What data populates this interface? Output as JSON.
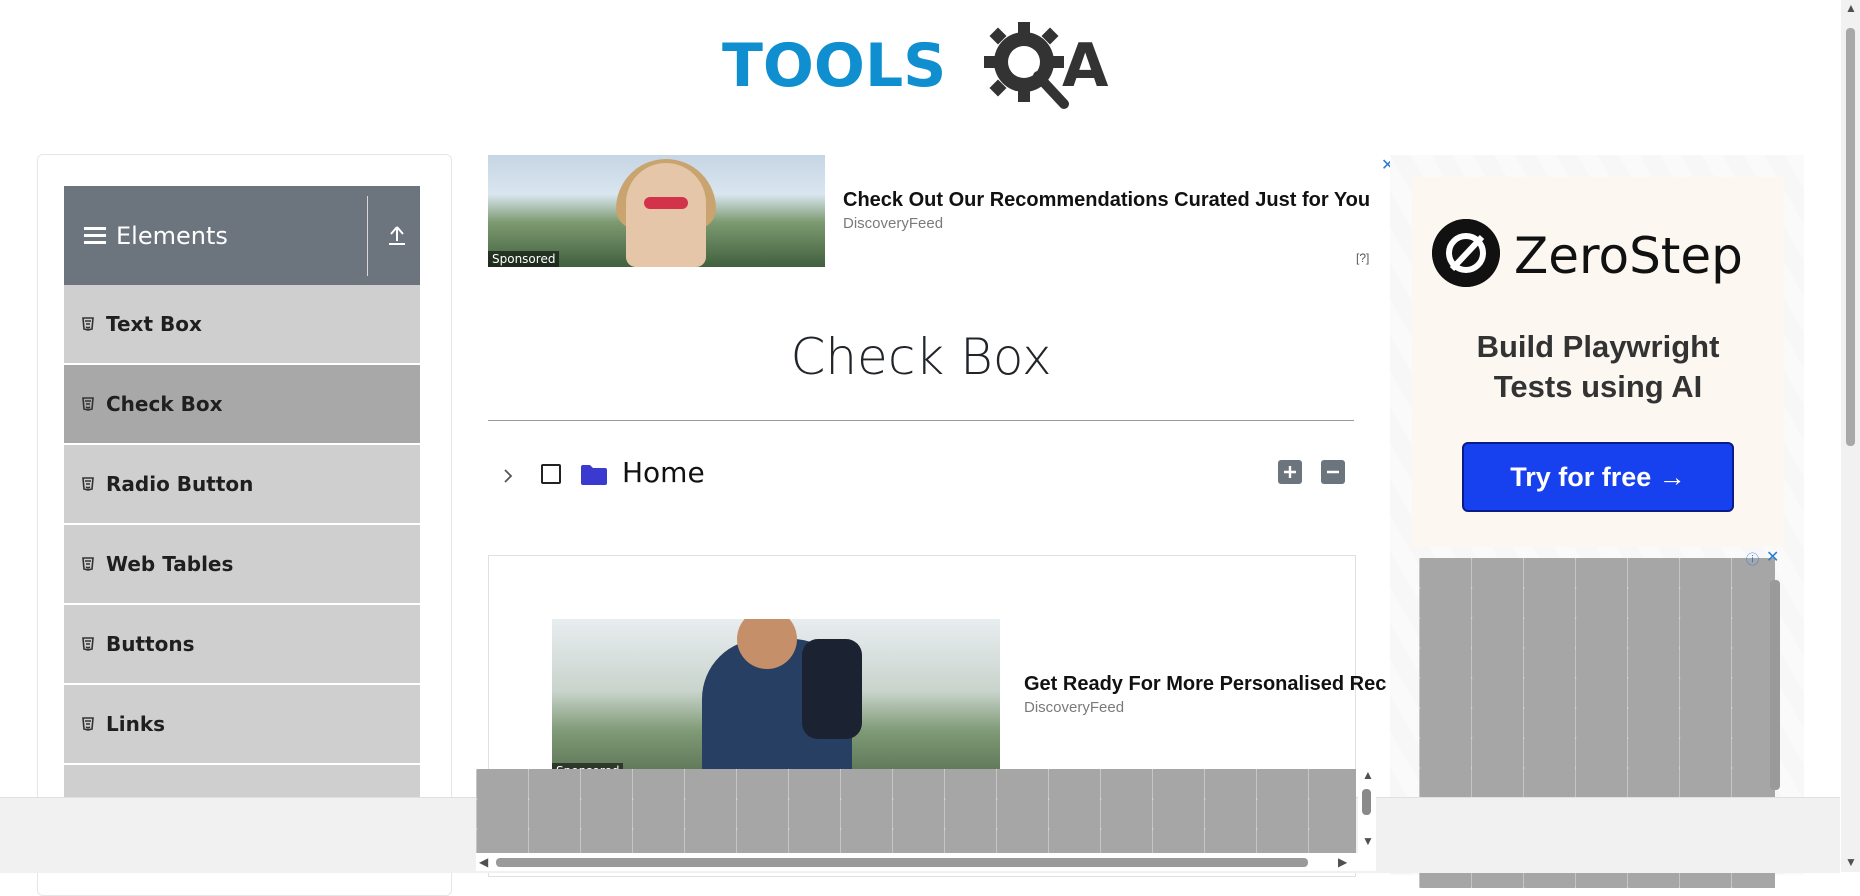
{
  "header": {
    "logo_tools": "TOOLS",
    "logo_qa_q": "Q",
    "logo_qa_a": "A"
  },
  "sidebar": {
    "group_title": "Elements",
    "items": [
      {
        "label": "Text Box",
        "active": false
      },
      {
        "label": "Check Box",
        "active": true
      },
      {
        "label": "Radio Button",
        "active": false
      },
      {
        "label": "Web Tables",
        "active": false
      },
      {
        "label": "Buttons",
        "active": false
      },
      {
        "label": "Links",
        "active": false
      }
    ]
  },
  "ad_top": {
    "sponsored": "Sponsored",
    "title": "Check Out Our Recommendations Curated Just for You",
    "source": "DiscoveryFeed",
    "info": "[?]",
    "close": "✕"
  },
  "main": {
    "title": "Check Box",
    "tree": {
      "root_label": "Home"
    }
  },
  "ad_mid": {
    "sponsored": "Sponsored",
    "title": "Get Ready For More Personalised Rec",
    "source": "DiscoveryFeed"
  },
  "ad_right": {
    "brand": "ZeroStep",
    "tagline_line1": "Build Playwright",
    "tagline_line2": "Tests using AI",
    "cta": "Try for free →",
    "info": "ⓘ",
    "close": "✕"
  },
  "colors": {
    "brand_blue": "#0f8fcf",
    "brand_dark": "#333333",
    "sidebar_header": "#6c757d",
    "menu_item": "#cfcfcf",
    "menu_item_active": "#a8a8a8",
    "cta_blue": "#1740ee",
    "folder_blue": "#3a3ad0"
  }
}
